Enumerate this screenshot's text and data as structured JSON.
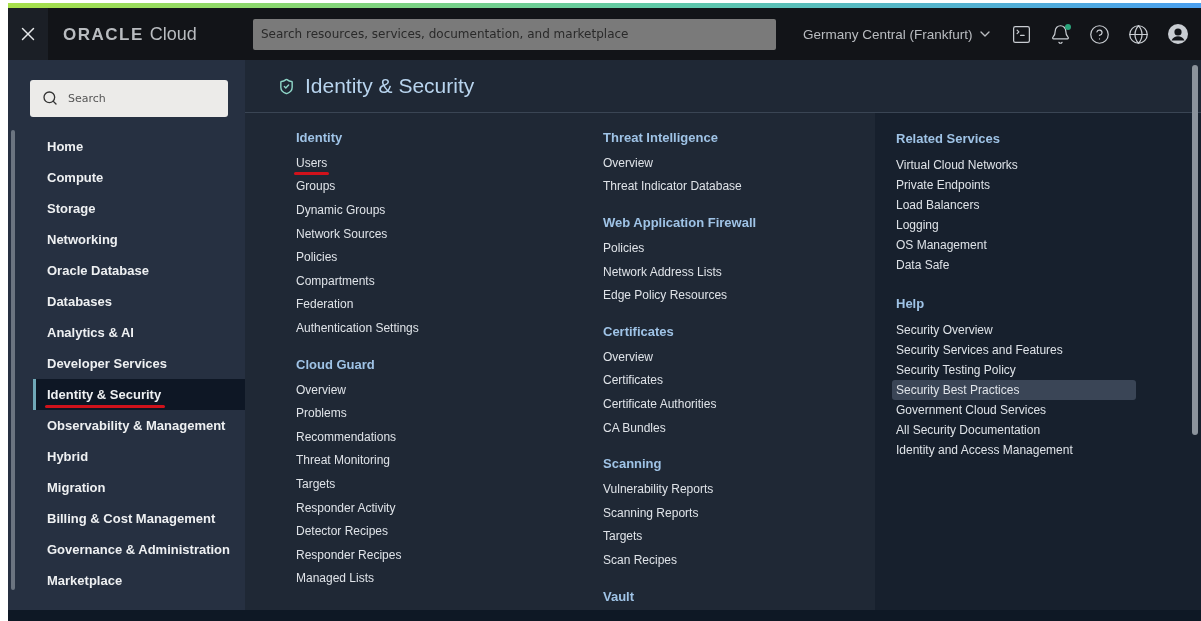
{
  "header": {
    "logo": {
      "brand": "ORACLE",
      "product": "Cloud"
    },
    "search": {
      "placeholder": "Search resources, services, documentation, and marketplace"
    },
    "region": "Germany Central (Frankfurt)",
    "has_unread_notifications": true
  },
  "sidebar": {
    "search": {
      "placeholder": "Search"
    },
    "items": [
      {
        "label": "Home",
        "selected": false,
        "underlined": false
      },
      {
        "label": "Compute",
        "selected": false,
        "underlined": false
      },
      {
        "label": "Storage",
        "selected": false,
        "underlined": false
      },
      {
        "label": "Networking",
        "selected": false,
        "underlined": false
      },
      {
        "label": "Oracle Database",
        "selected": false,
        "underlined": false
      },
      {
        "label": "Databases",
        "selected": false,
        "underlined": false
      },
      {
        "label": "Analytics & AI",
        "selected": false,
        "underlined": false
      },
      {
        "label": "Developer Services",
        "selected": false,
        "underlined": false
      },
      {
        "label": "Identity & Security",
        "selected": true,
        "underlined": true
      },
      {
        "label": "Observability & Management",
        "selected": false,
        "underlined": false
      },
      {
        "label": "Hybrid",
        "selected": false,
        "underlined": false
      },
      {
        "label": "Migration",
        "selected": false,
        "underlined": false
      },
      {
        "label": "Billing & Cost Management",
        "selected": false,
        "underlined": false
      },
      {
        "label": "Governance & Administration",
        "selected": false,
        "underlined": false
      },
      {
        "label": "Marketplace",
        "selected": false,
        "underlined": false
      }
    ]
  },
  "panel": {
    "title": "Identity & Security",
    "columns": [
      {
        "kind": "main",
        "sections": [
          {
            "heading": "Identity",
            "links": [
              {
                "label": "Users",
                "selected": false,
                "underlined": true
              },
              {
                "label": "Groups",
                "selected": false,
                "underlined": false
              },
              {
                "label": "Dynamic Groups",
                "selected": false,
                "underlined": false
              },
              {
                "label": "Network Sources",
                "selected": false,
                "underlined": false
              },
              {
                "label": "Policies",
                "selected": false,
                "underlined": false
              },
              {
                "label": "Compartments",
                "selected": false,
                "underlined": false
              },
              {
                "label": "Federation",
                "selected": false,
                "underlined": false
              },
              {
                "label": "Authentication Settings",
                "selected": false,
                "underlined": false
              }
            ]
          },
          {
            "heading": "Cloud Guard",
            "links": [
              {
                "label": "Overview",
                "selected": false,
                "underlined": false
              },
              {
                "label": "Problems",
                "selected": false,
                "underlined": false
              },
              {
                "label": "Recommendations",
                "selected": false,
                "underlined": false
              },
              {
                "label": "Threat Monitoring",
                "selected": false,
                "underlined": false
              },
              {
                "label": "Targets",
                "selected": false,
                "underlined": false
              },
              {
                "label": "Responder Activity",
                "selected": false,
                "underlined": false
              },
              {
                "label": "Detector Recipes",
                "selected": false,
                "underlined": false
              },
              {
                "label": "Responder Recipes",
                "selected": false,
                "underlined": false
              },
              {
                "label": "Managed Lists",
                "selected": false,
                "underlined": false
              }
            ]
          }
        ]
      },
      {
        "kind": "main",
        "sections": [
          {
            "heading": "Threat Intelligence",
            "links": [
              {
                "label": "Overview",
                "selected": false,
                "underlined": false
              },
              {
                "label": "Threat Indicator Database",
                "selected": false,
                "underlined": false
              }
            ]
          },
          {
            "heading": "Web Application Firewall",
            "links": [
              {
                "label": "Policies",
                "selected": false,
                "underlined": false
              },
              {
                "label": "Network Address Lists",
                "selected": false,
                "underlined": false
              },
              {
                "label": "Edge Policy Resources",
                "selected": false,
                "underlined": false
              }
            ]
          },
          {
            "heading": "Certificates",
            "links": [
              {
                "label": "Overview",
                "selected": false,
                "underlined": false
              },
              {
                "label": "Certificates",
                "selected": false,
                "underlined": false
              },
              {
                "label": "Certificate Authorities",
                "selected": false,
                "underlined": false
              },
              {
                "label": "CA Bundles",
                "selected": false,
                "underlined": false
              }
            ]
          },
          {
            "heading": "Scanning",
            "links": [
              {
                "label": "Vulnerability Reports",
                "selected": false,
                "underlined": false
              },
              {
                "label": "Scanning Reports",
                "selected": false,
                "underlined": false
              },
              {
                "label": "Targets",
                "selected": false,
                "underlined": false
              },
              {
                "label": "Scan Recipes",
                "selected": false,
                "underlined": false
              }
            ]
          },
          {
            "heading": "Vault"
          }
        ]
      },
      {
        "kind": "aside",
        "sections": [
          {
            "heading": "Related Services",
            "links": [
              {
                "label": "Virtual Cloud Networks",
                "selected": false,
                "underlined": false
              },
              {
                "label": "Private Endpoints",
                "selected": false,
                "underlined": false
              },
              {
                "label": "Load Balancers",
                "selected": false,
                "underlined": false
              },
              {
                "label": "Logging",
                "selected": false,
                "underlined": false
              },
              {
                "label": "OS Management",
                "selected": false,
                "underlined": false
              },
              {
                "label": "Data Safe",
                "selected": false,
                "underlined": false
              }
            ]
          },
          {
            "heading": "Help",
            "links": [
              {
                "label": "Security Overview",
                "selected": false,
                "underlined": false
              },
              {
                "label": "Security Services and Features",
                "selected": false,
                "underlined": false
              },
              {
                "label": "Security Testing Policy",
                "selected": false,
                "underlined": false
              },
              {
                "label": "Security Best Practices",
                "selected": true,
                "underlined": false
              },
              {
                "label": "Government Cloud Services",
                "selected": false,
                "underlined": false
              },
              {
                "label": "All Security Documentation",
                "selected": false,
                "underlined": false
              },
              {
                "label": "Identity and Access Management",
                "selected": false,
                "underlined": false
              }
            ]
          }
        ]
      }
    ]
  }
}
